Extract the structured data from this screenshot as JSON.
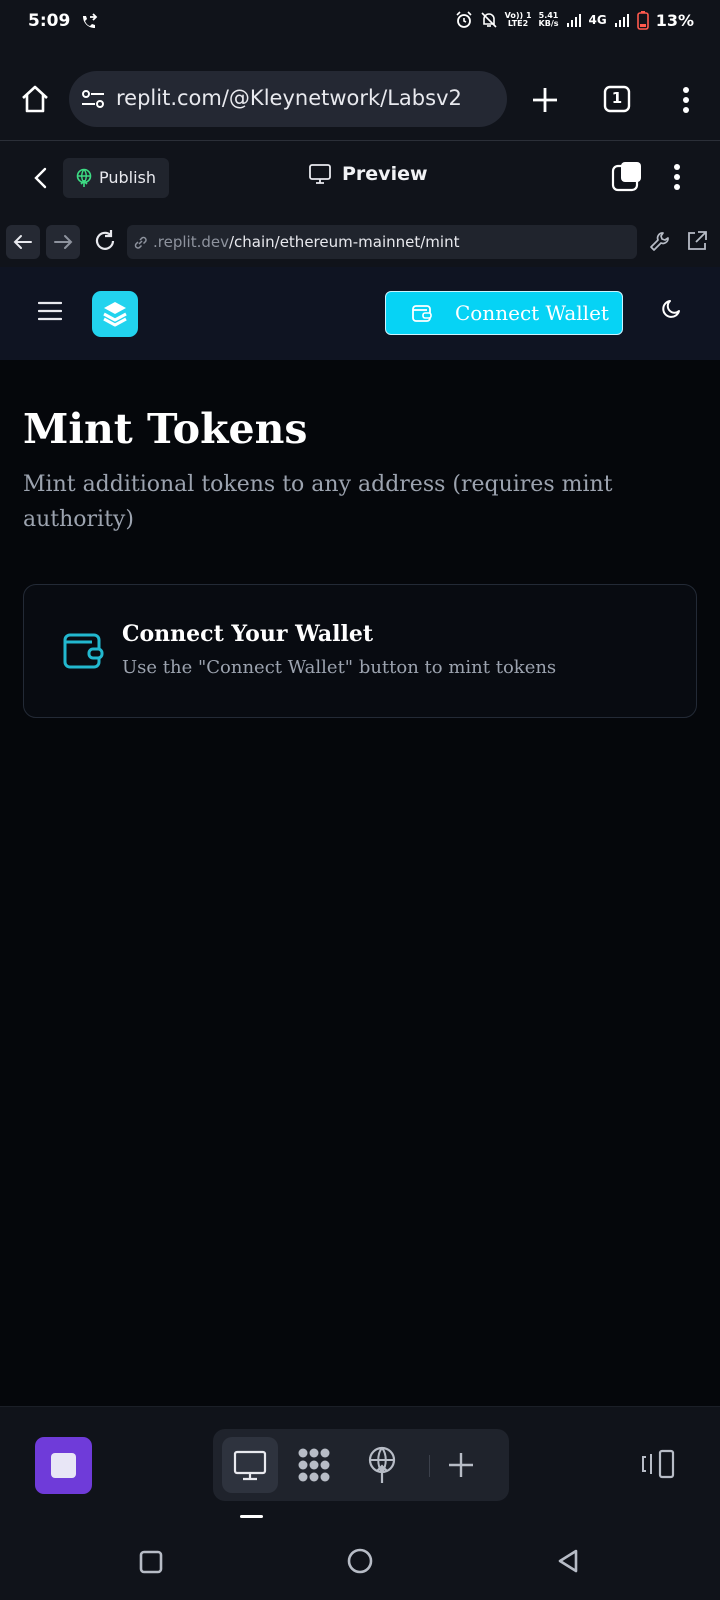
{
  "status_bar": {
    "time": "5:09",
    "volte_line1": "Vo)) 1",
    "volte_line2": "LTE2",
    "speed_line1": "5.41",
    "speed_line2": "KB/s",
    "net_type": "4G",
    "battery": "13%",
    "battery_color": "#ff5a4e"
  },
  "browser": {
    "url": "replit.com/@Kleynetwork/Labsv2",
    "tab_count": "1"
  },
  "replit_header": {
    "publish_label": "Publish",
    "preview_label": "Preview"
  },
  "devtools": {
    "url_domain": ".replit.dev",
    "url_path": "/chain/ethereum-mainnet/mint"
  },
  "app": {
    "connect_wallet_label": "Connect Wallet",
    "accent": "#06d3f5"
  },
  "page": {
    "title": "Mint Tokens",
    "subtitle": "Mint additional tokens to any address (requires mint authority)",
    "card": {
      "title": "Connect Your Wallet",
      "description": "Use the \"Connect Wallet\" button to mint tokens"
    }
  }
}
